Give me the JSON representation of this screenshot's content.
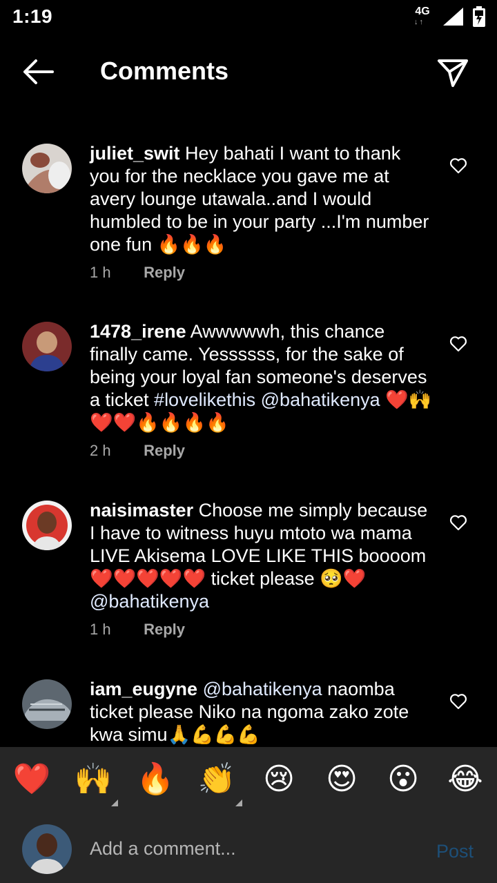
{
  "status_bar": {
    "time": "1:19",
    "network": "4G",
    "network_arrows": "↓↑"
  },
  "header": {
    "title": "Comments",
    "back_icon": "arrow-left-icon",
    "share_icon": "paper-plane-icon"
  },
  "comments": [
    {
      "username": "juliet_swit",
      "text": "Hey bahati I want to thank you for the necklace you gave me at avery lounge utawala..and I would humbled to be in your party ...I'm number one fun 🔥🔥🔥",
      "time": "1 h",
      "reply_label": "Reply"
    },
    {
      "username": "1478_irene",
      "text_before": "Awwwwwh, this chance finally came. Yessssss, for the sake of being your loyal fan someone's deserves a ticket ",
      "hashtag": "#lovelikethis",
      "mention": "@bahatikenya",
      "text_after": "❤️🙌❤️❤️🔥🔥🔥🔥",
      "time": "2 h",
      "reply_label": "Reply"
    },
    {
      "username": "naisimaster",
      "text": "Choose me simply because I have to witness huyu mtoto wa mama LIVE Akisema LOVE LIKE THIS boooom ❤️❤️❤️❤️❤️ ticket please 🥺❤️",
      "mention": "@bahatikenya",
      "time": "1 h",
      "reply_label": "Reply"
    },
    {
      "username": "iam_eugyne",
      "mention": "@bahatikenya",
      "text": "naomba ticket please Niko na ngoma zako zote kwa simu🙏💪💪💪"
    }
  ],
  "emoji_bar": [
    "❤️",
    "🙌",
    "🔥",
    "👏",
    "😢",
    "😍",
    "😮",
    "😂"
  ],
  "composer": {
    "placeholder": "Add a comment...",
    "post_label": "Post"
  },
  "colors": {
    "background": "#000000",
    "panel": "#262626",
    "muted": "#a8a8a8",
    "post_disabled": "#1d4f78"
  }
}
